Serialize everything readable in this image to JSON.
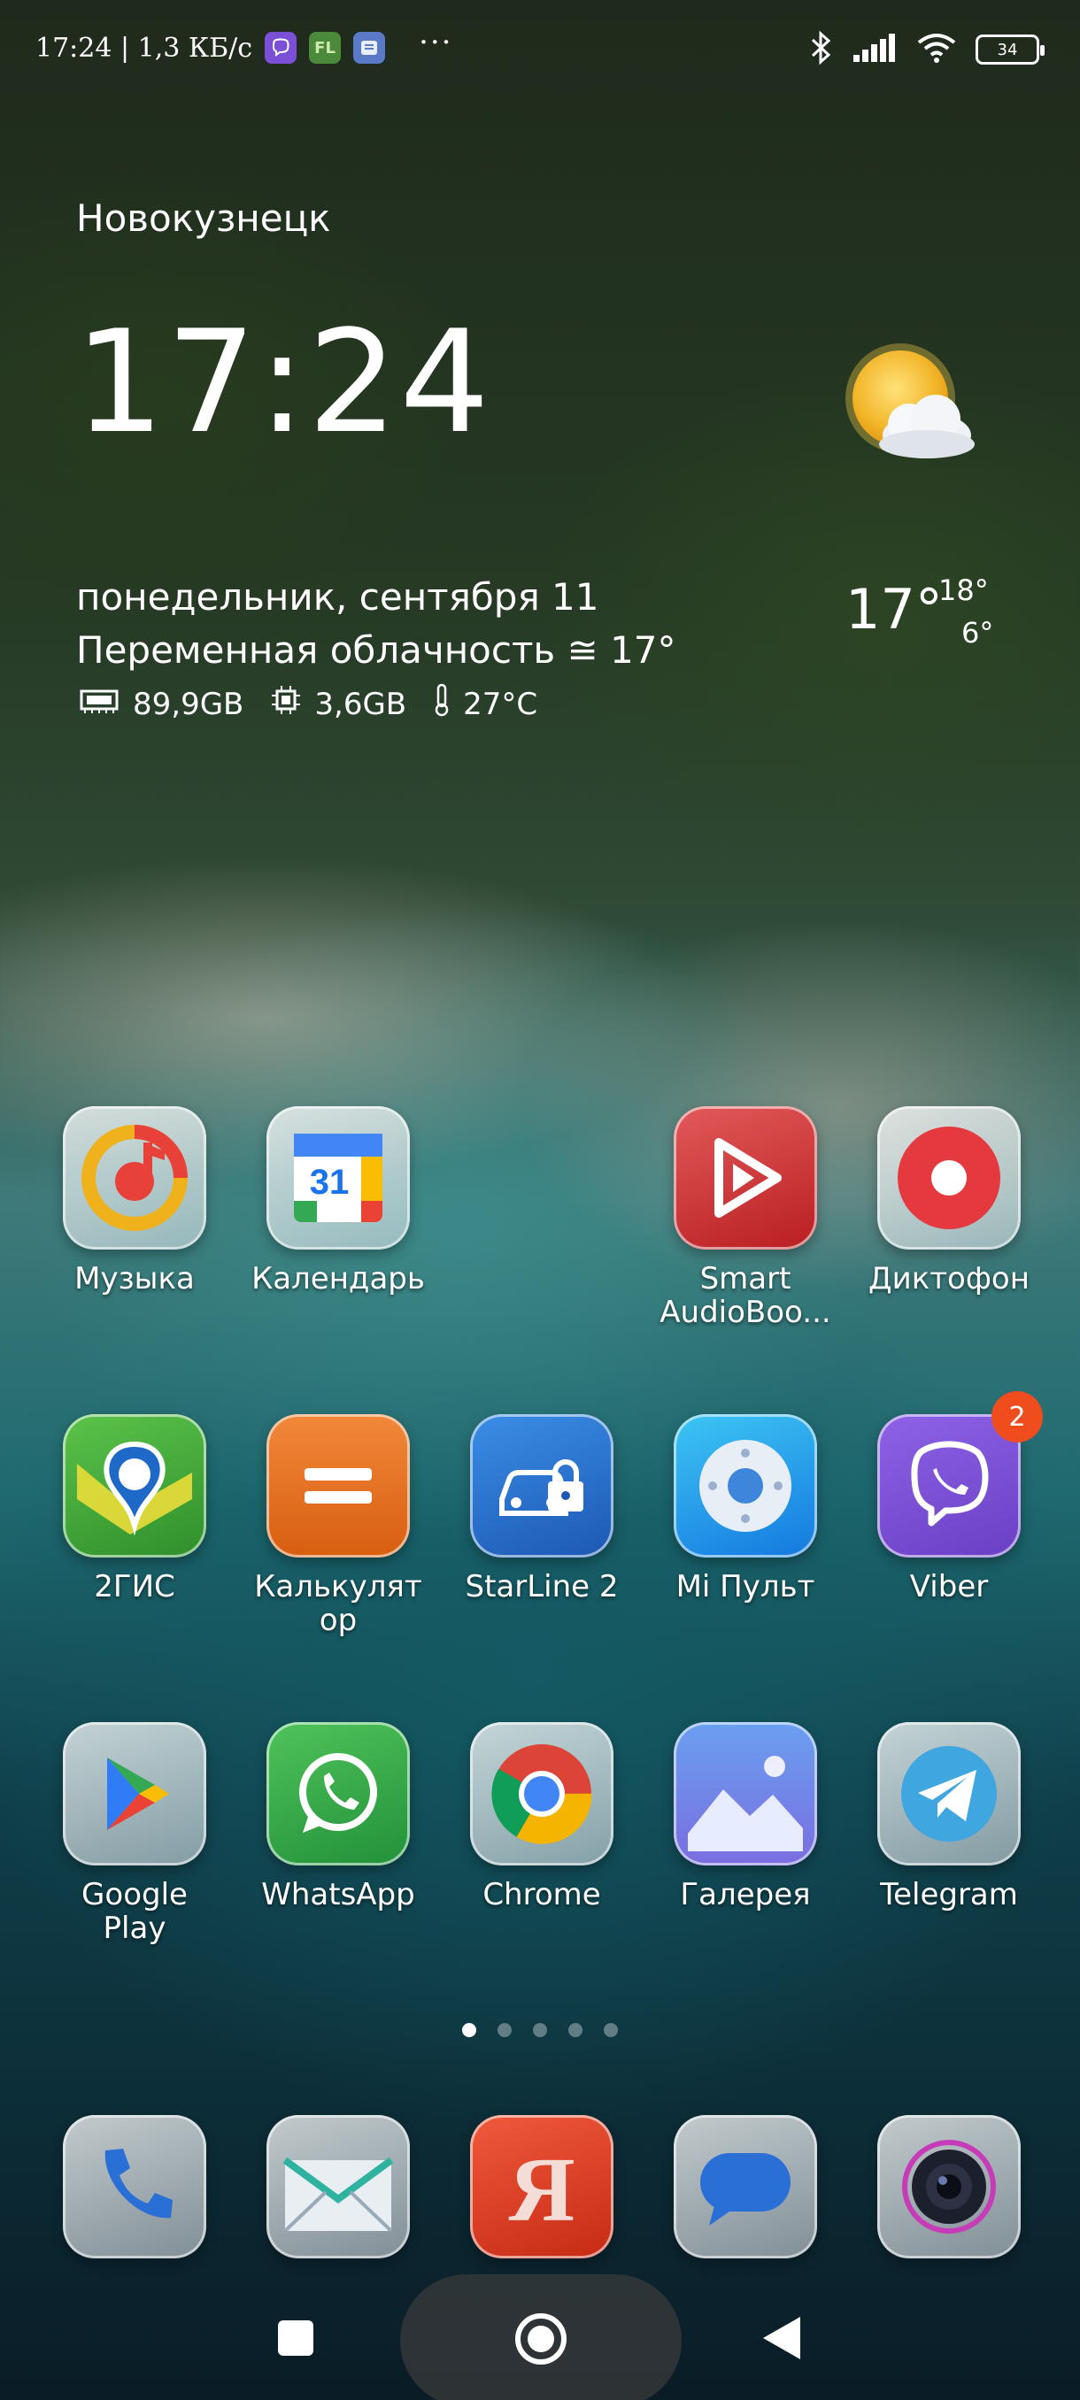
{
  "status_bar": {
    "time_speed": "17:24 | 1,3 КБ/с",
    "notification_icons": [
      "viber-icon",
      "fl-icon",
      "notes-icon"
    ],
    "more": "···",
    "battery": "34"
  },
  "widget": {
    "city": "Новокузнецк",
    "time": "17:24",
    "date": "понедельник, сентября 11",
    "condition": "Переменная облачность ≅ 17°",
    "storage": "89,9GB",
    "ram": "3,6GB",
    "cpu_temp": "27°C",
    "temp_now": "17°",
    "temp_high": "18°",
    "temp_low": "6°",
    "weather_icon": "partly-cloudy-icon"
  },
  "apps": [
    {
      "label": "Музыка",
      "icon": "music-icon"
    },
    {
      "label": "Календарь",
      "icon": "calendar-icon",
      "day": "31"
    },
    {
      "label": "Smart AudioBoo...",
      "icon": "audiobook-icon"
    },
    {
      "label": "Диктофон",
      "icon": "recorder-icon"
    },
    {
      "label": "2ГИС",
      "icon": "map-pin-icon"
    },
    {
      "label": "Калькулят ор",
      "icon": "calculator-icon"
    },
    {
      "label": "StarLine 2",
      "icon": "car-lock-icon"
    },
    {
      "label": "Mi Пульт",
      "icon": "remote-icon"
    },
    {
      "label": "Viber",
      "icon": "viber-icon",
      "badge": "2"
    },
    {
      "label": "Google Play",
      "icon": "play-store-icon"
    },
    {
      "label": "WhatsApp",
      "icon": "whatsapp-icon"
    },
    {
      "label": "Chrome",
      "icon": "chrome-icon"
    },
    {
      "label": "Галерея",
      "icon": "gallery-icon"
    },
    {
      "label": "Telegram",
      "icon": "telegram-icon"
    }
  ],
  "dock": [
    {
      "icon": "phone-icon"
    },
    {
      "icon": "mail-icon"
    },
    {
      "icon": "yandex-icon",
      "letter": "Я"
    },
    {
      "icon": "messages-icon"
    },
    {
      "icon": "camera-icon"
    }
  ],
  "pages": {
    "count": 5,
    "active": 1
  },
  "colors": {
    "badge": "#f04d1e",
    "viber": "#7b4fd6",
    "telegram": "#3fa6e0",
    "whatsapp": "#3ab54a"
  }
}
